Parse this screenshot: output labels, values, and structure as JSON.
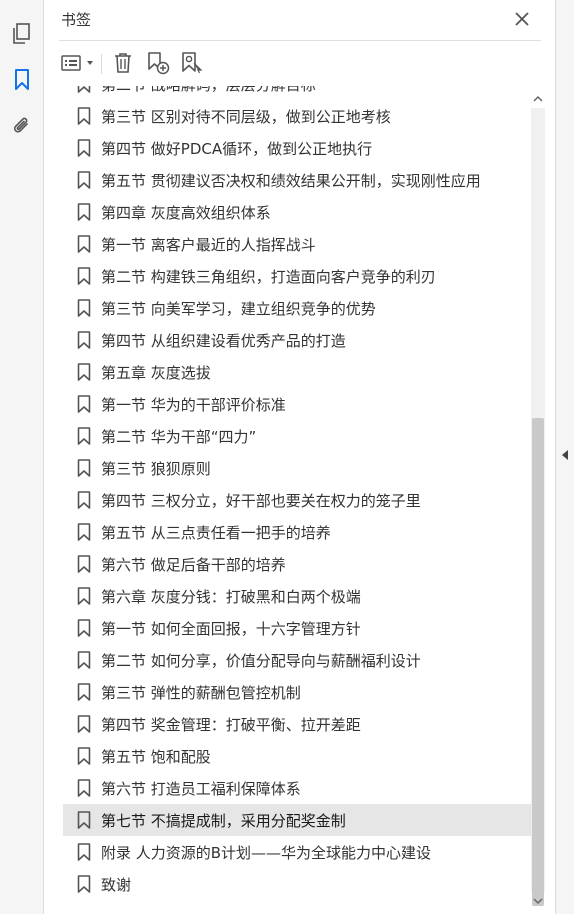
{
  "panel": {
    "title": "书签"
  },
  "rail": {
    "icons": [
      "pages-icon",
      "bookmark-icon",
      "attachment-icon"
    ],
    "accent": "#1473e6"
  },
  "toolbar": {
    "icons": [
      "options-menu-icon",
      "delete-icon",
      "new-bookmark-icon",
      "bookmark-from-selection-icon"
    ]
  },
  "bookmarks": [
    {
      "label": "第二节 战略解码，层层分解目标"
    },
    {
      "label": "第三节 区别对待不同层级，做到公正地考核"
    },
    {
      "label": "第四节 做好PDCA循环，做到公正地执行"
    },
    {
      "label": "第五节 贯彻建议否决权和绩效结果公开制，实现刚性应用"
    },
    {
      "label": "第四章 灰度高效组织体系"
    },
    {
      "label": "第一节 离客户最近的人指挥战斗"
    },
    {
      "label": "第二节 构建铁三角组织，打造面向客户竞争的利刃"
    },
    {
      "label": "第三节 向美军学习，建立组织竞争的优势"
    },
    {
      "label": "第四节 从组织建设看优秀产品的打造"
    },
    {
      "label": "第五章 灰度选拔"
    },
    {
      "label": "第一节 华为的干部评价标准"
    },
    {
      "label": "第二节 华为干部“四力”"
    },
    {
      "label": "第三节 狼狈原则"
    },
    {
      "label": "第四节 三权分立，好干部也要关在权力的笼子里"
    },
    {
      "label": "第五节 从三点责任看一把手的培养"
    },
    {
      "label": "第六节 做足后备干部的培养"
    },
    {
      "label": "第六章 灰度分钱：打破黑和白两个极端"
    },
    {
      "label": "第一节 如何全面回报，十六字管理方针"
    },
    {
      "label": "第二节 如何分享，价值分配导向与薪酬福利设计"
    },
    {
      "label": "第三节 弹性的薪酬包管控机制"
    },
    {
      "label": "第四节 奖金管理：打破平衡、拉开差距"
    },
    {
      "label": "第五节 饱和配股"
    },
    {
      "label": "第六节 打造员工福利保障体系"
    },
    {
      "label": "第七节 不搞提成制，采用分配奖金制",
      "selected": true
    },
    {
      "label": "附录 人力资源的B计划——华为全球能力中心建设"
    },
    {
      "label": "致谢"
    }
  ]
}
